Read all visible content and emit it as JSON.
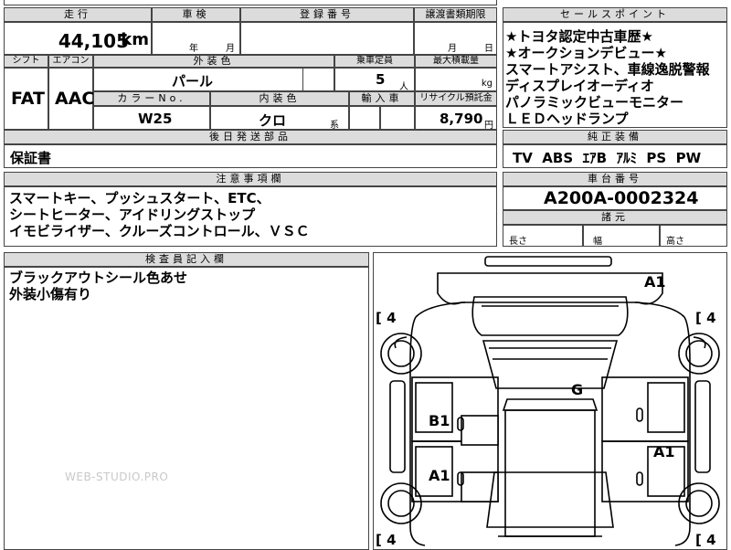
{
  "row0": {
    "top_strip": "... 車検 ... 登録番号 ..."
  },
  "mileage": {
    "header": "走行",
    "value": "44,105",
    "unit": "km"
  },
  "inspection": {
    "header": "車検",
    "year_unit": "年",
    "month_unit": "月"
  },
  "registration": {
    "header": "登録番号"
  },
  "transfer": {
    "header": "譲渡書類期限",
    "month_unit": "月",
    "day_unit": "日"
  },
  "shift": {
    "header": "シフト",
    "value": "FAT"
  },
  "aircon": {
    "header": "エアコン",
    "value": "AAC"
  },
  "exterior_color": {
    "header": "外装色",
    "value": "パール"
  },
  "capacity": {
    "header": "乗車定員",
    "value": "5",
    "unit": "人"
  },
  "max_load": {
    "header": "最大積載量",
    "unit": "kg"
  },
  "color_no": {
    "header": "カラーNo.",
    "value": "W25"
  },
  "interior_color": {
    "header": "内装色",
    "value": "クロ",
    "suffix": "系"
  },
  "import": {
    "header": "輸入車"
  },
  "recycle": {
    "header": "リサイクル預託金",
    "value": "8,790",
    "unit": "円"
  },
  "later_parts": {
    "header": "後日発送部品",
    "value": "保証書"
  },
  "sales_points": {
    "header": "セールスポイント",
    "lines": [
      "★トヨタ認定中古車歴★",
      "★オークションデビュー★",
      "スマートアシスト、車線逸脱警報",
      "ディスプレイオーディオ",
      "パノラミックビューモニター",
      "ＬＥＤヘッドランプ"
    ]
  },
  "equipment": {
    "header": "純正装備",
    "value": "TV  ABS  ｴｱB  ｱﾙﾐ  PS  PW"
  },
  "notes": {
    "header": "注意事項欄",
    "lines": [
      "スマートキー、プッシュスタート、ETC、",
      "シートヒーター、アイドリングストップ",
      "イモビライザー、クルーズコントロール、ＶＳＣ"
    ]
  },
  "chassis": {
    "header": "車台番号",
    "value": "A200A-0002324"
  },
  "dimensions": {
    "header": "諸元",
    "length": "長さ",
    "width": "幅",
    "height": "高さ"
  },
  "inspector": {
    "header": "検査員記入欄",
    "lines": [
      "ブラックアウトシール色あせ",
      "外装小傷有り"
    ]
  },
  "watermark": "WEB-STUDIO.PRO",
  "diagram": {
    "tire_tl": "[ 4",
    "tire_tr": "[ 4",
    "tire_bl": "[ 4",
    "tire_br": "[ 4",
    "mark_front": "A1",
    "mark_g": "G",
    "mark_b1": "B1",
    "mark_a1_left": "A1",
    "mark_a1_right": "A1"
  }
}
